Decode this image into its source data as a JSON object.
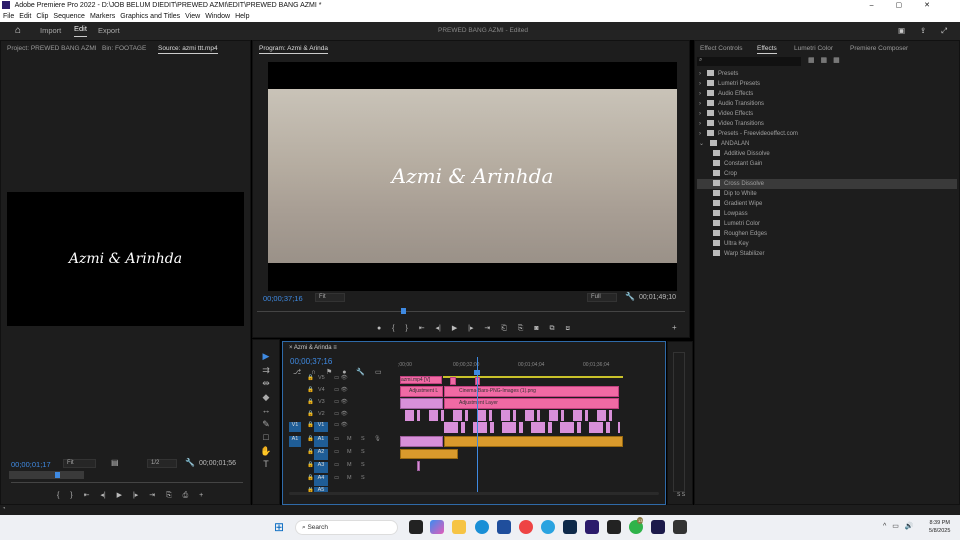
{
  "app": {
    "title": "Adobe Premiere Pro 2022 - D:\\JOB BELUM DIEDIT\\PREWED AZMI\\EDIT\\PREWED BANG AZMI *"
  },
  "menu": [
    "File",
    "Edit",
    "Clip",
    "Sequence",
    "Markers",
    "Graphics and Titles",
    "View",
    "Window",
    "Help"
  ],
  "header": {
    "import": "Import",
    "edit": "Edit",
    "export": "Export",
    "project_title": "PREWED BANG AZMI",
    "status": "Edited"
  },
  "source": {
    "tabs": [
      "Project: PREWED BANG AZMI",
      "Bin: FOOTAGE",
      "Source: azmi ttt.mp4"
    ],
    "overlay_text": "Azmi & Arinhda",
    "timecode": "00;00;01;17",
    "zoom": "Fit",
    "resolution": "1/2",
    "duration": "00;00;01;56"
  },
  "program": {
    "tab": "Program: Azmi & Arinda",
    "overlay_text": "Azmi & Arinhda",
    "timecode": "00;00;37;16",
    "zoom": "Fit",
    "resolution": "Full",
    "duration": "00;01;49;10"
  },
  "timeline": {
    "tab": "Azmi & Arinda",
    "timecode": "00;00;37;16",
    "ruler": [
      ";00;00",
      "00;00;32;00",
      "00;01;04;04",
      "00;01;36;04"
    ],
    "video_tracks": [
      "V5",
      "V4",
      "V3",
      "V2",
      "V1"
    ],
    "audio_tracks": [
      "A1",
      "A2",
      "A3",
      "A4",
      "A5"
    ],
    "src_v": "V1",
    "src_a": "A1",
    "mute": "M",
    "solo": "S",
    "clips": {
      "v5": "azmi.mp4 [V]",
      "v4a": "Adjustment L",
      "v4b": "Cinema-Bars-PNG-Images (1).png",
      "v3": "Adjustment Layer"
    }
  },
  "effects": {
    "tabs": [
      "Effect Controls",
      "Effects",
      "Lumetri Color",
      "Premiere Composer"
    ],
    "search_placeholder": "",
    "folders": [
      "Presets",
      "Lumetri Presets",
      "Audio Effects",
      "Audio Transitions",
      "Video Effects",
      "Video Transitions",
      "Presets - Freevideoeffect.com",
      "ANDALAN"
    ],
    "items": [
      "Additive Dissolve",
      "Constant Gain",
      "Crop",
      "Cross Dissolve",
      "Dip to White",
      "Gradient Wipe",
      "Lowpass",
      "Lumetri Color",
      "Roughen Edges",
      "Ultra Key",
      "Warp Stabilizer"
    ],
    "selected": "Cross Dissolve"
  },
  "taskbar": {
    "search": "Search",
    "time": "8:39 PM",
    "date": "5/8/2025",
    "badge": "13"
  },
  "colors": {
    "accent": "#3f8ae2",
    "clip_pink": "#f06aa4",
    "clip_violet": "#d890d9",
    "clip_audio": "#d99a2c"
  }
}
